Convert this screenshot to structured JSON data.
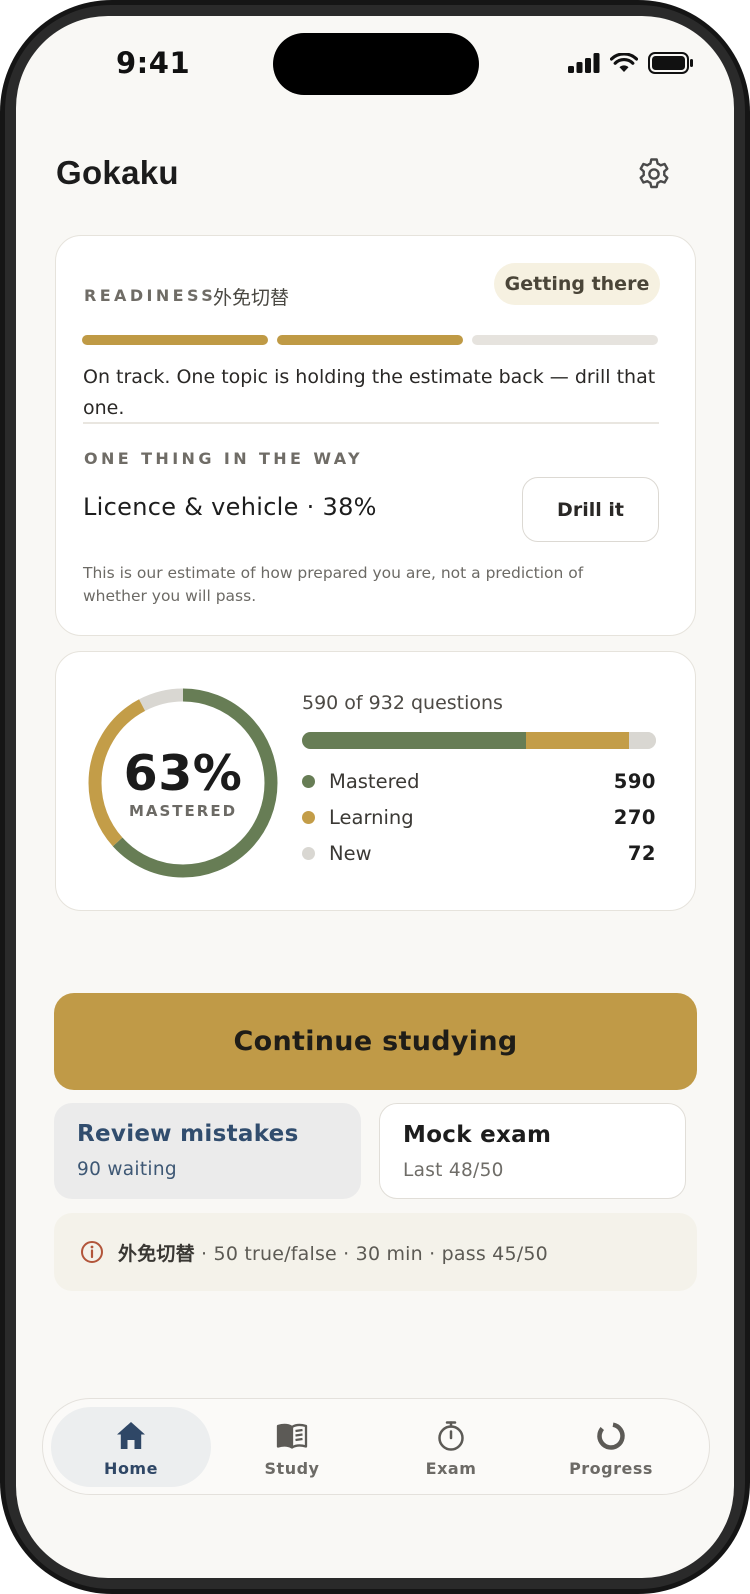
{
  "status_bar": {
    "time": "9:41",
    "signal_icon": "cellular-signal-icon",
    "wifi_icon": "wifi-icon",
    "battery_icon": "battery-icon"
  },
  "header": {
    "title": "Gokaku",
    "settings_icon": "gear-icon"
  },
  "readiness": {
    "label": "READINESS",
    "exam_code": "外免切替",
    "status_badge": "Getting there",
    "segments_filled": 2,
    "segments_total": 3,
    "summary": "On track. One topic is holding the estimate back — drill that one.",
    "blocker_label": "ONE THING IN THE WAY",
    "blocker_topic": "Licence & vehicle · 38%",
    "drill_button": "Drill it",
    "disclaimer": "This is our estimate of how prepared you are, not a prediction of whether you will pass."
  },
  "mastery": {
    "percent_label": "63%",
    "caption": "MASTERED",
    "questions_summary": "590 of 932 questions",
    "total": 932,
    "breakdown": [
      {
        "name": "Mastered",
        "value": "590",
        "count": 590,
        "color": "#677d55"
      },
      {
        "name": "Learning",
        "value": "270",
        "count": 270,
        "color": "#c39d48"
      },
      {
        "name": "New",
        "value": "72",
        "count": 72,
        "color": "#d9d7d2"
      }
    ]
  },
  "actions": {
    "continue_label": "Continue studying",
    "review": {
      "title": "Review mistakes",
      "subtitle": "90 waiting"
    },
    "mock": {
      "title": "Mock exam",
      "subtitle": "Last 48/50"
    }
  },
  "exam_info": {
    "icon": "info-icon",
    "name": "外免切替",
    "details": " · 50 true/false · 30 min · pass 45/50"
  },
  "tabs": [
    {
      "label": "Home",
      "icon": "home-icon",
      "active": true
    },
    {
      "label": "Study",
      "icon": "book-icon",
      "active": false
    },
    {
      "label": "Exam",
      "icon": "stopwatch-icon",
      "active": false
    },
    {
      "label": "Progress",
      "icon": "progress-ring-icon",
      "active": false
    }
  ],
  "colors": {
    "accent": "#c09a47",
    "mastered": "#677d55",
    "learning": "#c39d48",
    "new": "#d9d7d2",
    "nav_active": "#2f4766"
  }
}
